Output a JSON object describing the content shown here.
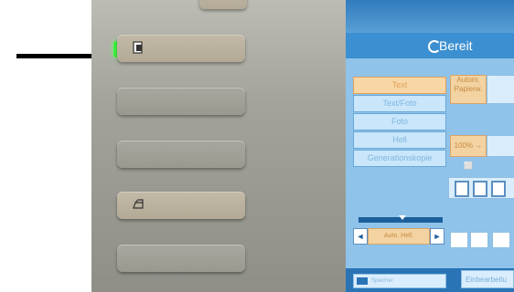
{
  "panel": {
    "buttons": [
      {
        "id": "top",
        "icon": "button-icon"
      },
      {
        "id": "document",
        "icon": "document-icon",
        "led": "on"
      },
      {
        "id": "blank2",
        "icon": ""
      },
      {
        "id": "blank3",
        "icon": ""
      },
      {
        "id": "printer",
        "icon": "printer-icon"
      },
      {
        "id": "blank5",
        "icon": ""
      }
    ],
    "led_color": "#3ef23e"
  },
  "screen": {
    "status": "Bereit",
    "modes": [
      {
        "label": "Text",
        "selected": true
      },
      {
        "label": "Text/Foto",
        "selected": false
      },
      {
        "label": "Foto",
        "selected": false
      },
      {
        "label": "Hell",
        "selected": false
      },
      {
        "label": "Generationskopie",
        "selected": false
      }
    ],
    "auto_paper": "Autom. Papierw.",
    "zoom": "100% → ⬜",
    "density_auto": "Auto. Hell.",
    "density_left": "◄",
    "density_right": "►",
    "bottom_label": "Speicher",
    "bottom_right": "Einbearbeitu",
    "accent": "#1f6fb5",
    "selected_color": "#f7d7a5"
  }
}
